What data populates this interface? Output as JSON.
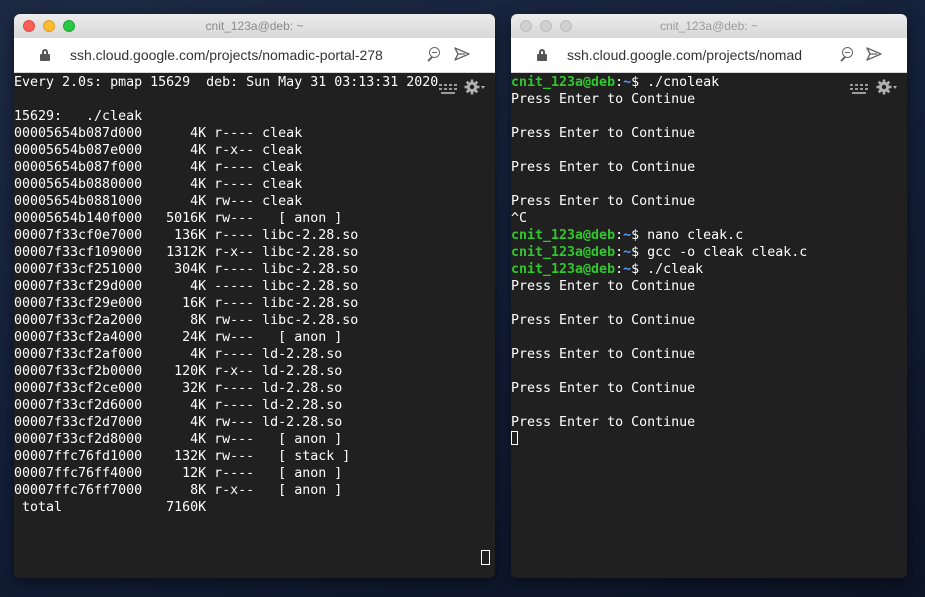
{
  "left_window": {
    "title": "cnit_123a@deb: ~",
    "url": "ssh.cloud.google.com/projects/nomadic-portal-278",
    "header_line": "Every 2.0s: pmap 15629  deb: Sun May 31 03:13:31 2020",
    "process_line": "15629:   ./cleak",
    "pmap_rows": [
      "00005654b087d000      4K r---- cleak",
      "00005654b087e000      4K r-x-- cleak",
      "00005654b087f000      4K r---- cleak",
      "00005654b0880000      4K r---- cleak",
      "00005654b0881000      4K rw--- cleak",
      "00005654b140f000   5016K rw---   [ anon ]",
      "00007f33cf0e7000    136K r---- libc-2.28.so",
      "00007f33cf109000   1312K r-x-- libc-2.28.so",
      "00007f33cf251000    304K r---- libc-2.28.so",
      "00007f33cf29d000      4K ----- libc-2.28.so",
      "00007f33cf29e000     16K r---- libc-2.28.so",
      "00007f33cf2a2000      8K rw--- libc-2.28.so",
      "00007f33cf2a4000     24K rw---   [ anon ]",
      "00007f33cf2af000      4K r---- ld-2.28.so",
      "00007f33cf2b0000    120K r-x-- ld-2.28.so",
      "00007f33cf2ce000     32K r---- ld-2.28.so",
      "00007f33cf2d6000      4K r---- ld-2.28.so",
      "00007f33cf2d7000      4K rw--- ld-2.28.so",
      "00007f33cf2d8000      4K rw---   [ anon ]",
      "00007ffc76fd1000    132K rw---   [ stack ]",
      "00007ffc76ff4000     12K r----   [ anon ]",
      "00007ffc76ff7000      8K r-x--   [ anon ]"
    ],
    "total_line": " total             7160K"
  },
  "right_window": {
    "title": "cnit_123a@deb: ~",
    "url": "ssh.cloud.google.com/projects/nomad",
    "prompt_user": "cnit_123a@deb",
    "prompt_sep": ":",
    "prompt_path": "~",
    "prompt_dollar": "$",
    "cmd1": " ./cnoleak",
    "press": "Press Enter to Continue",
    "ctrl_c": "^C",
    "cmd2": " nano cleak.c",
    "cmd3": " gcc -o cleak cleak.c",
    "cmd4": " ./cleak"
  }
}
